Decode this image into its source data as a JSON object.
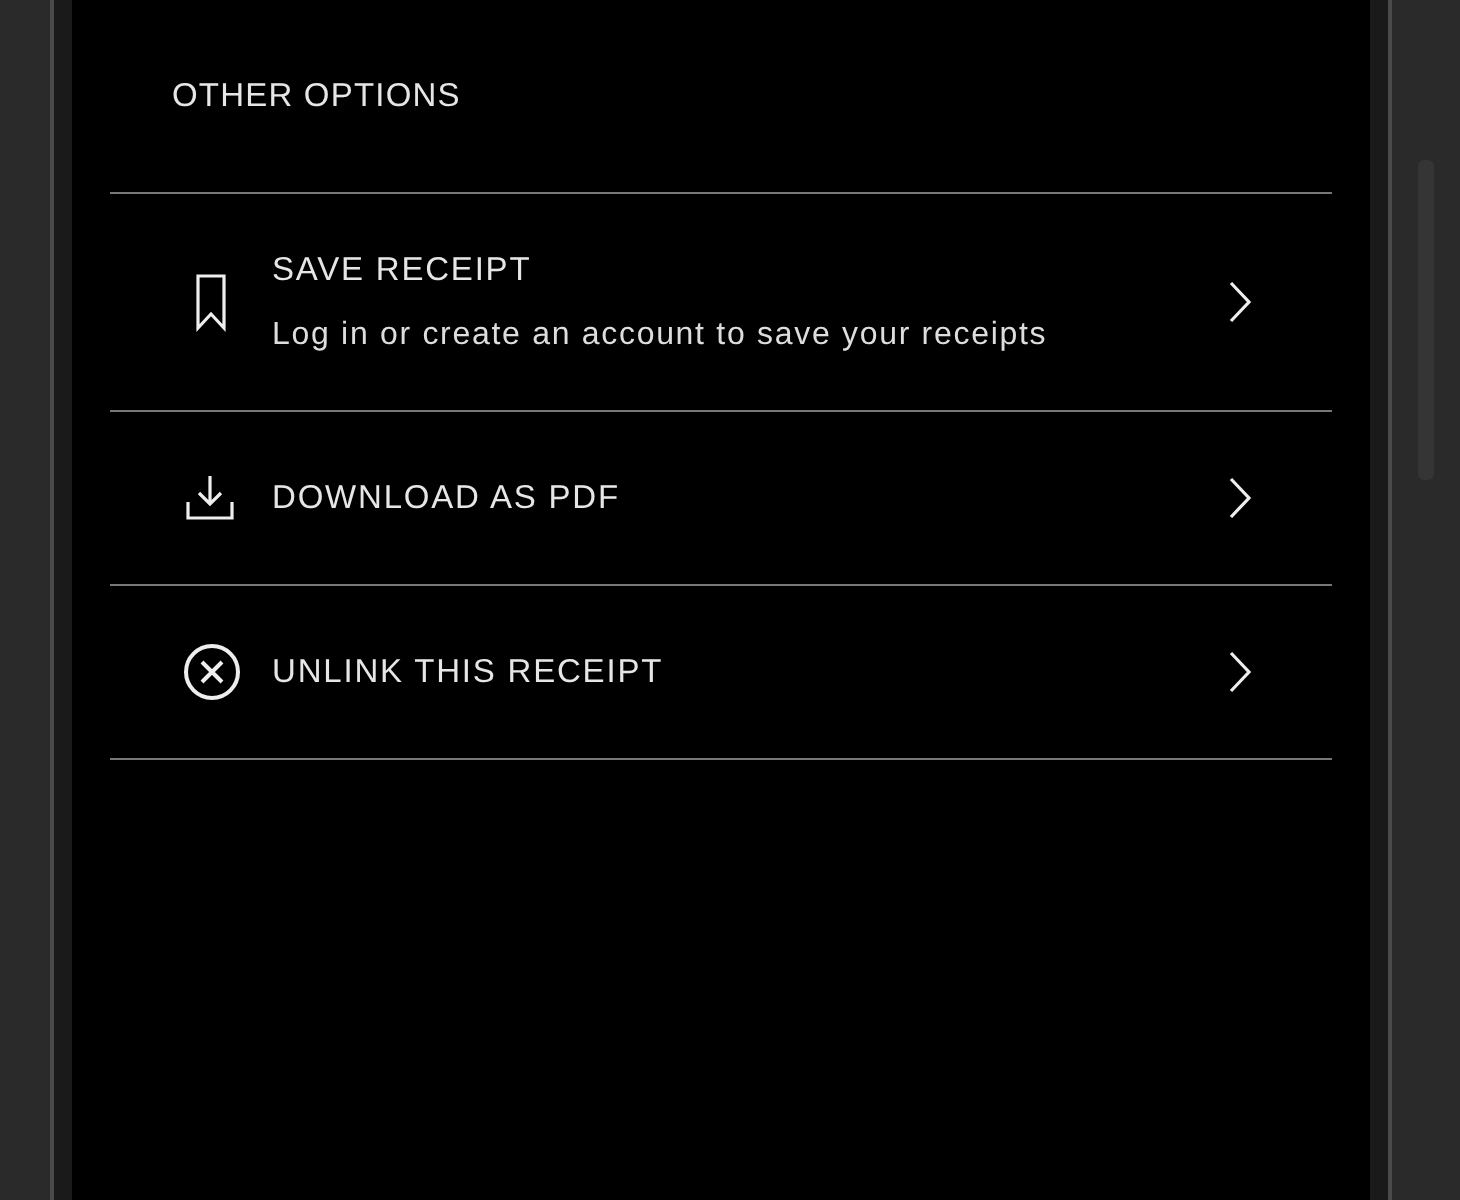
{
  "section_title": "OTHER OPTIONS",
  "options": [
    {
      "title": "SAVE RECEIPT",
      "subtitle": "Log in or create an account to save your receipts"
    },
    {
      "title": "DOWNLOAD AS PDF"
    },
    {
      "title": "UNLINK THIS RECEIPT"
    }
  ]
}
